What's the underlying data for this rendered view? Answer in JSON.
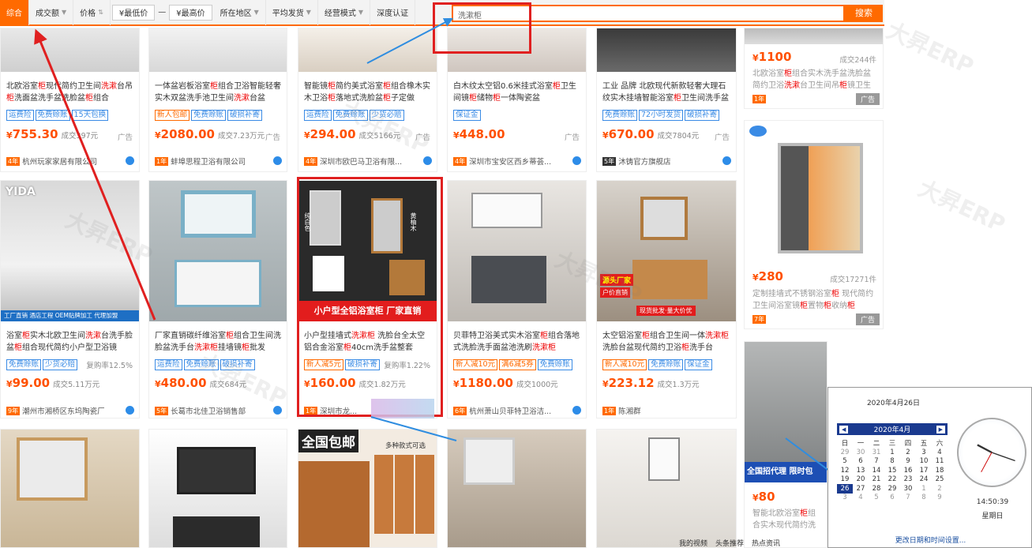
{
  "toolbar": {
    "items": [
      {
        "label": "综合"
      },
      {
        "label": "成交额"
      },
      {
        "label": "价格"
      },
      {
        "label": "¥最低价"
      },
      {
        "label": "—"
      },
      {
        "label": "¥最高价"
      },
      {
        "label": "所在地区"
      },
      {
        "label": "平均发货"
      },
      {
        "label": "经营模式"
      },
      {
        "label": "深度认证"
      }
    ],
    "search_value": "洗漱柜",
    "search_btn": "搜索"
  },
  "cards": [
    {
      "title": "北欧浴室柜现代简约卫生间洗漱台吊柜洗面盆洗手盆洗脸盆柜组合",
      "tags": [
        "运费险",
        "免费赊账",
        "15天包换"
      ],
      "price": "755.30",
      "sales": "成交397元",
      "ad": "广告",
      "year": "4年",
      "shop": "杭州玩家家居有限公司"
    },
    {
      "title": "一体盆岩板浴室柜组合卫浴智能轻奢实木双盆洗手池卫生间洗漱台盆",
      "tags": [
        "新人包邮",
        "免费赊账",
        "破损补寄"
      ],
      "price": "2080.00",
      "sales": "成交7.23万元",
      "ad": "广告",
      "year": "1年",
      "shop": "蚌埠思程卫浴有限公司"
    },
    {
      "title": "智能镜柜简约美式浴室柜组合橡木实木卫浴柜落地式洗脸盆柜子定做",
      "tags": [
        "运费险",
        "免费赊账",
        "少货必赔"
      ],
      "price": "294.00",
      "sales": "成交5166元",
      "ad": "广告",
      "year": "4年",
      "shop": "深圳市欧巴马卫浴有限..."
    },
    {
      "title": "白木纹太空铝0.6米挂式浴室柜卫生间镜柜储物柜一体陶瓷盆",
      "tags": [
        "保证金"
      ],
      "price": "448.00",
      "sales": "",
      "ad": "广告",
      "year": "4年",
      "shop": "深圳市宝安区西乡蒂荟..."
    },
    {
      "title": "工业 品牌 北欧现代新款轻奢大理石纹实木挂墙智能浴室柜卫生间洗手盆",
      "tags": [
        "免费赊账",
        "72小时发货",
        "破损补寄"
      ],
      "price": "670.00",
      "sales": "成交7804元",
      "ad": "广告",
      "year": "5年",
      "shop": "沐铸官方旗舰店"
    },
    {
      "title": "浴室柜实木北欧卫生间洗漱台洗手脸盆柜组合现代简约小户型卫浴镜",
      "tags": [
        "免费赊账",
        "少货必赔"
      ],
      "rate": "复购率12.5%",
      "price": "99.00",
      "sales": "成交5.11万元",
      "ad": "",
      "year": "9年",
      "shop": "潮州市湘桥区东坞陶瓷厂"
    },
    {
      "title": "厂家直销碳纤维浴室柜组合卫生间洗脸盆洗手台洗漱柜挂墙镜柜批发",
      "tags": [
        "运费险",
        "免费赊账",
        "破损补寄"
      ],
      "price": "480.00",
      "sales": "成交684元",
      "ad": "",
      "year": "5年",
      "shop": "长葛市北佳卫浴销售部"
    },
    {
      "title": "小户型挂墙式洗漱柜 洗脸台全太空铝合金浴室柜40cm洗手盆整套",
      "tags": [
        "新人减5元",
        "破损补寄"
      ],
      "rate": "复购率1.22%",
      "price": "160.00",
      "sales": "成交1.82万元",
      "ad": "",
      "year": "1年",
      "shop": "深圳市龙..."
    },
    {
      "title": "贝菲特卫浴美式实木浴室柜组合落地式洗脸洗手面盆池洗刷洗漱柜",
      "tags": [
        "新人减10元",
        "满6减5券",
        "免费赊账"
      ],
      "price": "1180.00",
      "sales": "成交1000元",
      "ad": "",
      "year": "6年",
      "shop": "杭州萧山贝菲特卫浴洁..."
    },
    {
      "title": "太空铝浴室柜组合卫生间一体洗漱柜洗脸台盆现代简约卫浴柜洗手台",
      "tags": [
        "新人减10元",
        "免费赊账",
        "保证金"
      ],
      "price": "223.12",
      "sales": "成交1.3万元",
      "ad": "",
      "year": "1年",
      "shop": "陈湘群"
    }
  ],
  "right_cards": [
    {
      "price": "1100",
      "sales": "成交244件",
      "title": "北欧浴室柜组合实木洗手盆洗脸盆简约卫浴洗漱台卫生间吊柜镜卫生间",
      "year": "1年",
      "ad": "广告"
    },
    {
      "price": "280",
      "sales": "成交17271件",
      "title": "定制挂墙式不锈钢浴室柜 现代简约卫生间浴室镜柜置物柜收纳柜",
      "year": "7年",
      "ad": "广告"
    },
    {
      "price": "80",
      "sales": "",
      "title": "智能北欧浴室柜组合实木现代简约洗手盆洗脸盆柜卫生间洗漱台",
      "year": "",
      "ad": ""
    }
  ],
  "image_text": {
    "vida": "YIDA",
    "promo1": "小户型全铝浴室柜 厂家直销",
    "promo2": "全国包邮",
    "promo2b": "多种款式可选",
    "promo3": "全国招代理 限时包",
    "white1": "纯白色",
    "white2": "黄柚木",
    "factory": "现货批发·量大价优",
    "factory2": "源头厂家",
    "factory3": "户价直销",
    "tag1": "工厂直销 酒店工程 OEM贴牌加工 代理加盟"
  },
  "watermark": "大昇ERP",
  "calendar": {
    "date": "2020年4月26日",
    "month": "2020年4月",
    "weekdays": [
      "日",
      "一",
      "二",
      "三",
      "四",
      "五",
      "六"
    ],
    "weeks": [
      [
        "29",
        "30",
        "31",
        "1",
        "2",
        "3",
        "4"
      ],
      [
        "5",
        "6",
        "7",
        "8",
        "9",
        "10",
        "11"
      ],
      [
        "12",
        "13",
        "14",
        "15",
        "16",
        "17",
        "18"
      ],
      [
        "19",
        "20",
        "21",
        "22",
        "23",
        "24",
        "25"
      ],
      [
        "26",
        "27",
        "28",
        "29",
        "30",
        "1",
        "2"
      ],
      [
        "3",
        "4",
        "5",
        "6",
        "7",
        "8",
        "9"
      ]
    ],
    "time": "14:50:39",
    "weekday": "星期日",
    "change": "更改日期和时间设置..."
  },
  "taskbar": [
    "我的视频",
    "头条推荐",
    "热点资讯"
  ],
  "colors": {
    "accent": "#ff6a00",
    "price": "#ff5000",
    "link": "#3a8be5"
  }
}
